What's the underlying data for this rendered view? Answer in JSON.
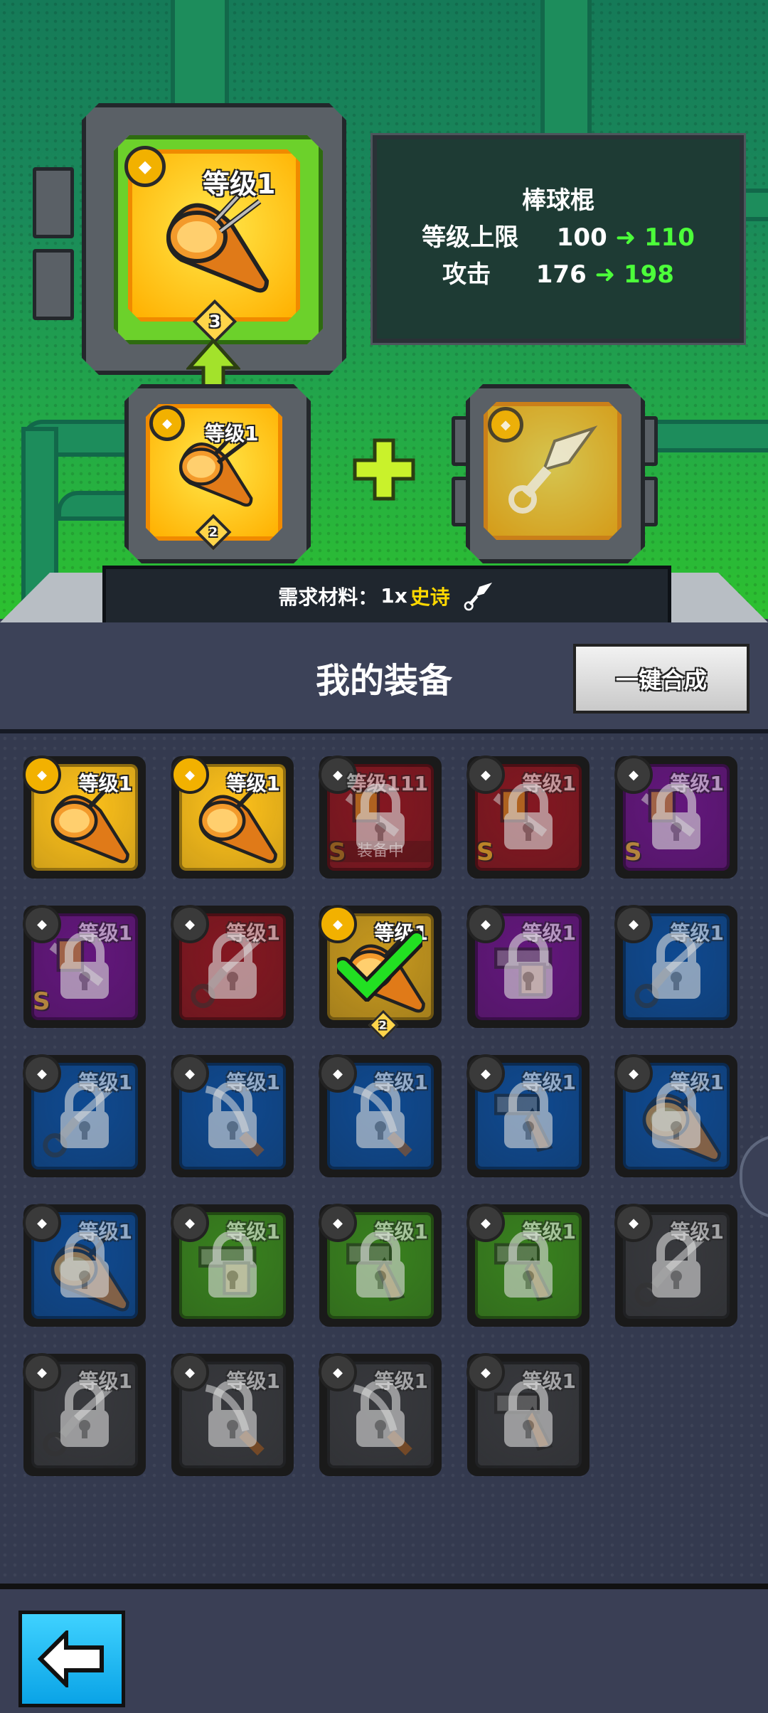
{
  "upgrade": {
    "result_level": "等级1",
    "result_stars": "3",
    "base_level": "等级1",
    "base_stars": "2"
  },
  "info": {
    "name": "棒球棍",
    "level_cap_label": "等级上限",
    "level_cap_from": "100",
    "level_cap_to": "110",
    "attack_label": "攻击",
    "attack_from": "176",
    "attack_to": "198"
  },
  "requirement": {
    "label": "需求材料：",
    "count": "1x",
    "rarity": "史诗",
    "rarity_color": "#ffd800"
  },
  "inventory": {
    "title": "我的装备",
    "combine_label": "一键合成",
    "items": [
      {
        "level": "等级1",
        "rarity": "gold",
        "locked": false,
        "icon": "bat-icon"
      },
      {
        "level": "等级1",
        "rarity": "gold",
        "locked": false,
        "icon": "bat-icon"
      },
      {
        "level": "等级111",
        "rarity": "red",
        "locked": true,
        "equipped": "装备中",
        "s": "S",
        "icon": "weapon-icon"
      },
      {
        "level": "等级1",
        "rarity": "red",
        "locked": true,
        "s": "S",
        "icon": "weapon-icon"
      },
      {
        "level": "等级1",
        "rarity": "purple",
        "locked": true,
        "s": "S",
        "icon": "weapon-icon"
      },
      {
        "level": "等级1",
        "rarity": "purple",
        "locked": true,
        "s": "S",
        "icon": "weapon-icon"
      },
      {
        "level": "等级1",
        "rarity": "red",
        "locked": true,
        "icon": "kunai-icon"
      },
      {
        "level": "等级1",
        "rarity": "gold-dim",
        "locked": false,
        "selected": true,
        "stars": "2",
        "icon": "bat-icon"
      },
      {
        "level": "等级1",
        "rarity": "purple",
        "locked": true,
        "icon": "gun-icon"
      },
      {
        "level": "等级1",
        "rarity": "blue",
        "locked": true,
        "icon": "kunai-icon"
      },
      {
        "level": "等级1",
        "rarity": "blue",
        "locked": true,
        "icon": "kunai-icon"
      },
      {
        "level": "等级1",
        "rarity": "blue",
        "locked": true,
        "icon": "sword-icon"
      },
      {
        "level": "等级1",
        "rarity": "blue",
        "locked": true,
        "icon": "sword-icon"
      },
      {
        "level": "等级1",
        "rarity": "blue",
        "locked": true,
        "icon": "revolver-icon"
      },
      {
        "level": "等级1",
        "rarity": "blue",
        "locked": true,
        "icon": "bat-icon"
      },
      {
        "level": "等级1",
        "rarity": "blue",
        "locked": true,
        "icon": "bat-icon"
      },
      {
        "level": "等级1",
        "rarity": "green",
        "locked": true,
        "icon": "gun-icon"
      },
      {
        "level": "等级1",
        "rarity": "green",
        "locked": true,
        "icon": "revolver-icon"
      },
      {
        "level": "等级1",
        "rarity": "green",
        "locked": true,
        "icon": "revolver-icon"
      },
      {
        "level": "等级1",
        "rarity": "gray",
        "locked": true,
        "icon": "kunai-icon"
      },
      {
        "level": "等级1",
        "rarity": "gray",
        "locked": true,
        "icon": "kunai-icon"
      },
      {
        "level": "等级1",
        "rarity": "gray",
        "locked": true,
        "icon": "sword-icon"
      },
      {
        "level": "等级1",
        "rarity": "gray",
        "locked": true,
        "icon": "sword-icon"
      },
      {
        "level": "等级1",
        "rarity": "gray",
        "locked": true,
        "icon": "revolver-icon"
      }
    ]
  },
  "colors": {
    "gold": "#ffc21a",
    "gold-dim": "#c99a1e",
    "red": "#b8202e",
    "purple": "#8a1fae",
    "blue": "#1466c9",
    "green": "#4fb52a",
    "gray": "#4d4f55",
    "accent_green": "#4cff3a"
  }
}
